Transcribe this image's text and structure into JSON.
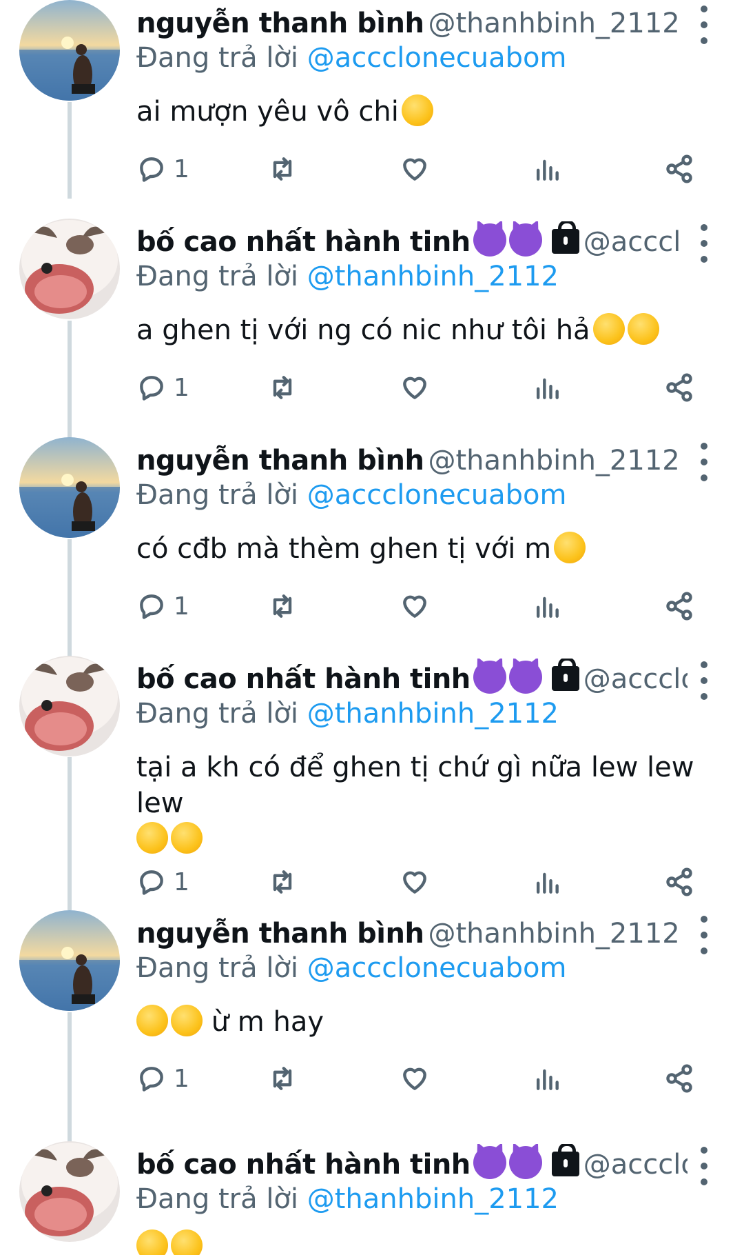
{
  "tweets": [
    {
      "user": "nguyễn thanh bình",
      "handle": "@thanhbinh_2112 · ...",
      "avatar": "sunset-beach",
      "replying_label": "Đang trả lời",
      "mention": "@accclonecuabom",
      "text": "ai mượn yêu vô chi",
      "text_emoji": [
        "smiling-face-with-hearts"
      ],
      "reply_count": "1"
    },
    {
      "user": "bố cao nhất hành tinh",
      "name_emoji": [
        "smiling-devil",
        "smiling-devil"
      ],
      "protected": true,
      "handle": "@acccl o...",
      "avatar": "cat",
      "replying_label": "Đang trả lời",
      "mention": "@thanhbinh_2112",
      "text": "a ghen tị với ng có nic như tôi hả",
      "text_emoji": [
        "smirking-face",
        "smirking-face"
      ],
      "reply_count": "1"
    },
    {
      "user": "nguyễn thanh bình",
      "handle": "@thanhbinh_2112 · ...",
      "avatar": "sunset-beach",
      "replying_label": "Đang trả lời",
      "mention": "@accclonecuabom",
      "text": "có cđb mà thèm ghen tị với m",
      "text_emoji": [
        "grinning-face"
      ],
      "reply_count": "1"
    },
    {
      "user": "bố cao nhất hành tinh",
      "name_emoji": [
        "smiling-devil",
        "smiling-devil"
      ],
      "protected": true,
      "handle": "@accclo...",
      "avatar": "cat",
      "replying_label": "Đang trả lời",
      "mention": "@thanhbinh_2112",
      "text": "tại a kh có để ghen tị chứ gì nữa lew lew lew",
      "text_emoji": [
        "face-with-tongue",
        "face-with-tongue"
      ],
      "reply_count": "1"
    },
    {
      "user": "nguyễn thanh bình",
      "handle": "@thanhbinh_2112 · ...",
      "avatar": "sunset-beach",
      "replying_label": "Đang trả lời",
      "mention": "@accclonecuabom",
      "text": "ừ m hay",
      "text_emoji_before": [
        "grinning-face",
        "grinning-face"
      ],
      "reply_count": "1"
    },
    {
      "user": "bố cao nhất hành tinh",
      "name_emoji": [
        "smiling-devil",
        "smiling-devil"
      ],
      "protected": true,
      "handle": "@accclo...",
      "avatar": "cat",
      "replying_label": "Đang trả lời",
      "mention": "@thanhbinh_2112",
      "text": "",
      "text_emoji": [
        "face-savoring-food",
        "face-savoring-food"
      ]
    }
  ],
  "icons": {
    "reply": "reply-icon",
    "retweet": "retweet-icon",
    "like": "heart-icon",
    "views": "analytics-icon",
    "share": "share-icon",
    "more": "more-options-icon"
  },
  "colors": {
    "link": "#1d9bf0",
    "secondary_text": "#536471",
    "thread_line": "#cfd9de"
  }
}
